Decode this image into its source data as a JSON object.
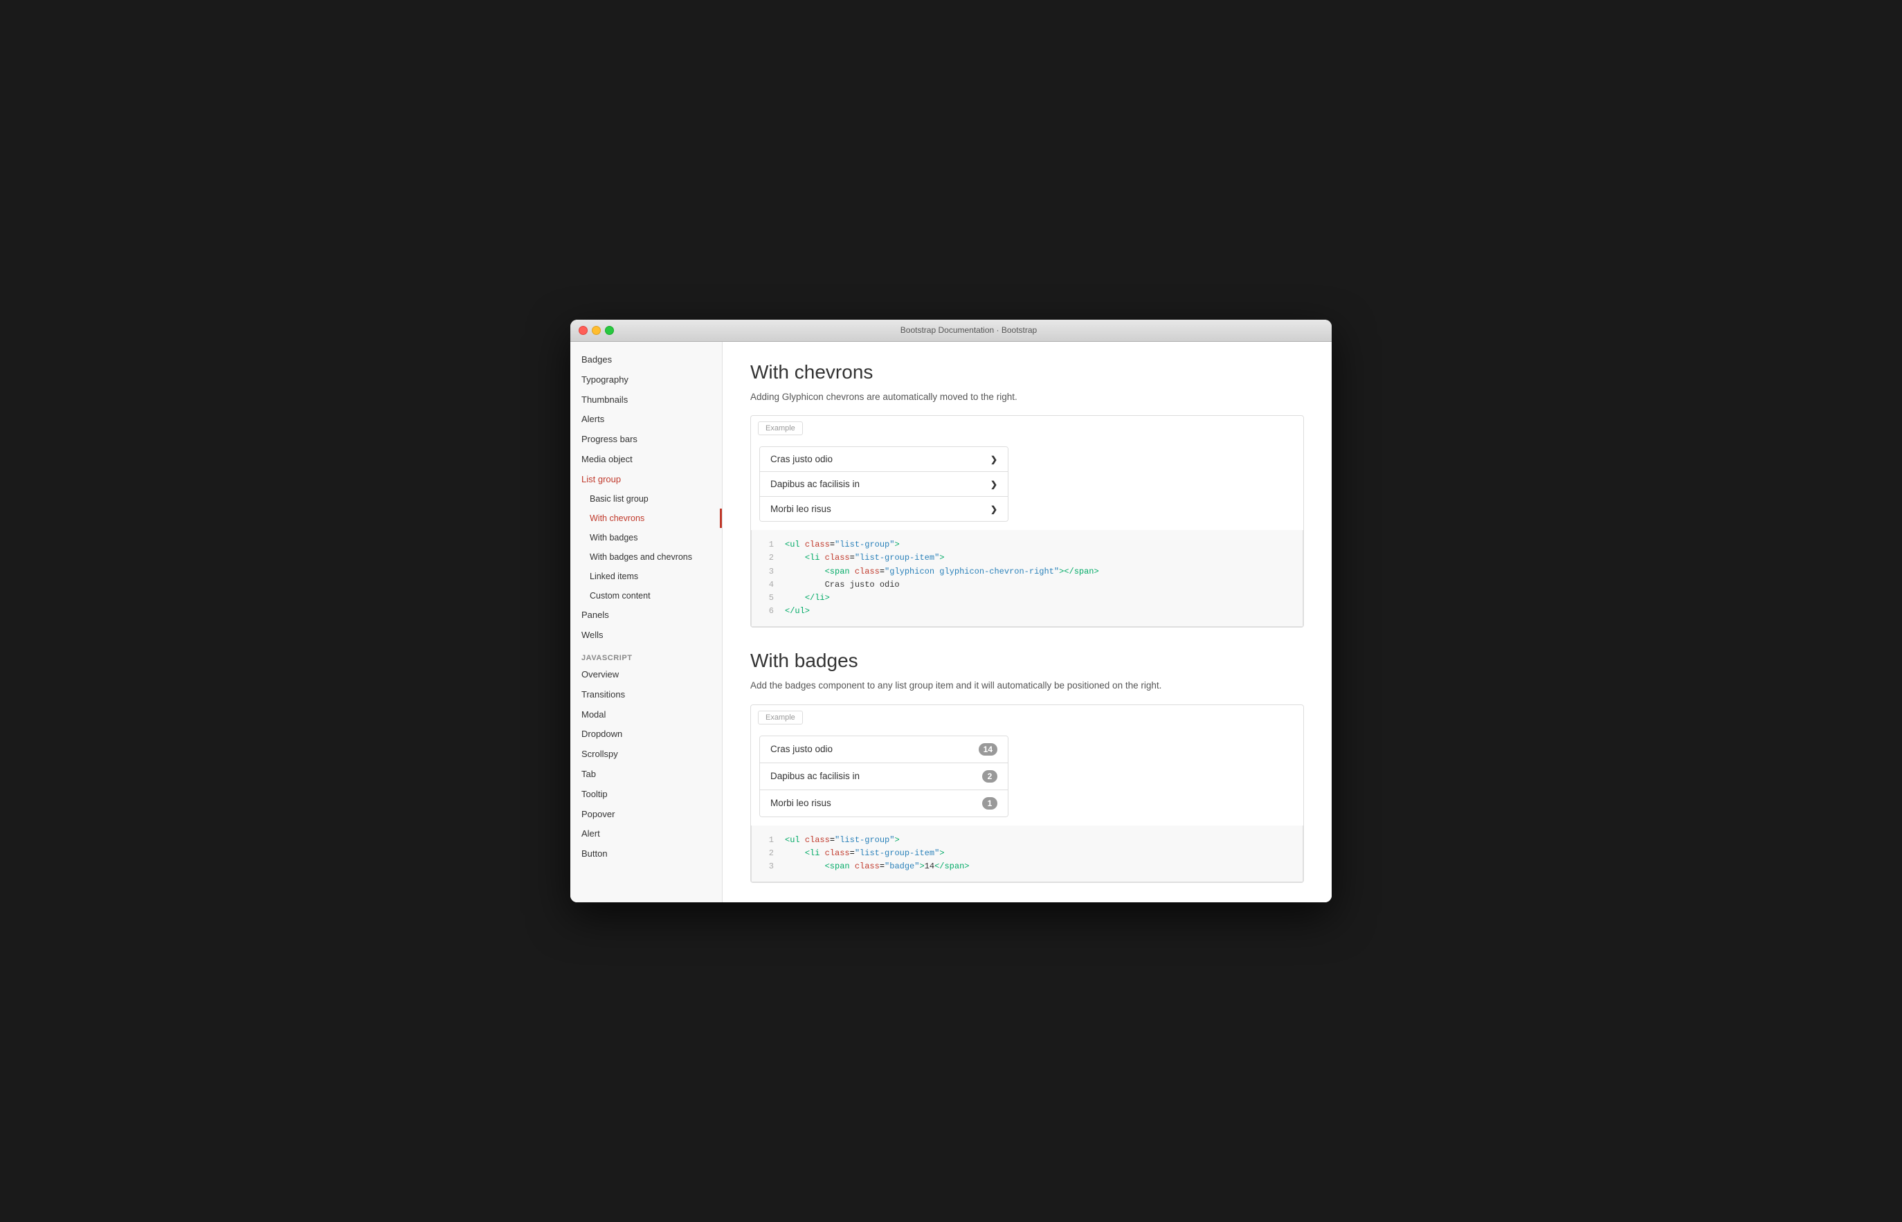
{
  "window": {
    "title": "Bootstrap Documentation · Bootstrap"
  },
  "sidebar": {
    "items": [
      {
        "label": "Badges",
        "level": "top",
        "active": false
      },
      {
        "label": "Typography",
        "level": "top",
        "active": false
      },
      {
        "label": "Thumbnails",
        "level": "top",
        "active": false
      },
      {
        "label": "Alerts",
        "level": "top",
        "active": false
      },
      {
        "label": "Progress bars",
        "level": "top",
        "active": false
      },
      {
        "label": "Media object",
        "level": "top",
        "active": false
      },
      {
        "label": "List group",
        "level": "top",
        "active": true
      },
      {
        "label": "Basic list group",
        "level": "sub",
        "active": false
      },
      {
        "label": "With chevrons",
        "level": "sub",
        "active": true
      },
      {
        "label": "With badges",
        "level": "sub",
        "active": false
      },
      {
        "label": "With badges and chevrons",
        "level": "sub",
        "active": false
      },
      {
        "label": "Linked items",
        "level": "sub",
        "active": false
      },
      {
        "label": "Custom content",
        "level": "sub",
        "active": false
      },
      {
        "label": "Panels",
        "level": "top",
        "active": false
      },
      {
        "label": "Wells",
        "level": "top",
        "active": false
      }
    ],
    "javascript_section": "JAVASCRIPT",
    "js_items": [
      "Overview",
      "Transitions",
      "Modal",
      "Dropdown",
      "Scrollspy",
      "Tab",
      "Tooltip",
      "Popover",
      "Alert",
      "Button"
    ]
  },
  "chevrons_section": {
    "title": "With chevrons",
    "description": "Adding Glyphicon chevrons are automatically moved to the right.",
    "example_label": "Example",
    "list_items": [
      {
        "text": "Cras justo odio"
      },
      {
        "text": "Dapibus ac facilisis in"
      },
      {
        "text": "Morbi leo risus"
      }
    ],
    "code_lines": [
      {
        "num": "1",
        "html": "<ul_class_list-group>"
      },
      {
        "num": "2",
        "html": "  <li_class_list-group-item>"
      },
      {
        "num": "3",
        "html": "    <span_class_glyphicon_glyphicon-chevron-right>"
      },
      {
        "num": "4",
        "html": "    Cras justo odio"
      },
      {
        "num": "5",
        "html": "  </li>"
      },
      {
        "num": "6",
        "html": "</ul>"
      }
    ]
  },
  "badges_section": {
    "title": "With badges",
    "description": "Add the badges component to any list group item and it will automatically be positioned on the right.",
    "example_label": "Example",
    "list_items": [
      {
        "text": "Cras justo odio",
        "badge": "14"
      },
      {
        "text": "Dapibus ac facilisis in",
        "badge": "2"
      },
      {
        "text": "Morbi leo risus",
        "badge": "1"
      }
    ],
    "code_lines": [
      {
        "num": "1",
        "content": "<ul class=\"list-group\">"
      },
      {
        "num": "2",
        "content": "  <li class=\"list-group-item\">"
      },
      {
        "num": "3",
        "content": "    <span class=\"badge\">14</span>"
      }
    ]
  }
}
